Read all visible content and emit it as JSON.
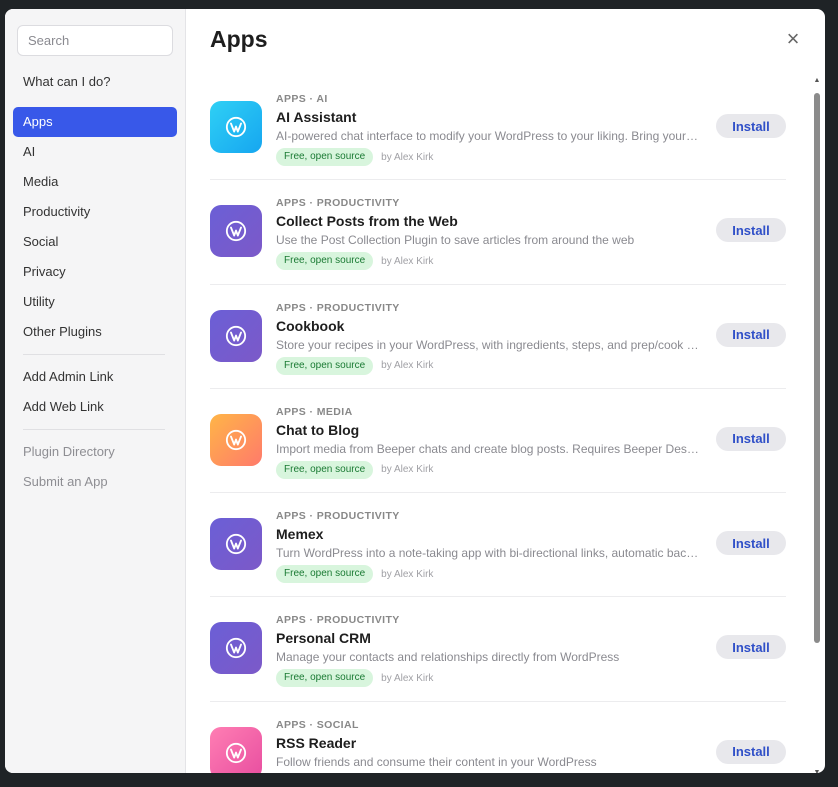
{
  "search": {
    "placeholder": "Search"
  },
  "sidebar": {
    "what_can": "What can I do?",
    "categories": [
      "Apps",
      "AI",
      "Media",
      "Productivity",
      "Social",
      "Privacy",
      "Utility",
      "Other Plugins"
    ],
    "links": [
      "Add Admin Link",
      "Add Web Link"
    ],
    "footer": [
      "Plugin Directory",
      "Submit an App"
    ]
  },
  "main": {
    "title": "Apps",
    "close": "×",
    "apps": [
      {
        "category": "APPS · AI",
        "name": "AI Assistant",
        "description": "AI-powered chat interface to modify your WordPress to your liking. Bring your own API key.",
        "badge": "Free, open source",
        "author": "by Alex Kirk",
        "button": "Install",
        "icon": "wordpress-icon",
        "gradient": [
          "#2fd0f5",
          "#16a6f0"
        ]
      },
      {
        "category": "APPS · PRODUCTIVITY",
        "name": "Collect Posts from the Web",
        "description": "Use the Post Collection Plugin to save articles from around the web",
        "badge": "Free, open source",
        "author": "by Alex Kirk",
        "button": "Install",
        "icon": "wordpress-icon",
        "gradient": [
          "#6b5fd6",
          "#7c59c8"
        ]
      },
      {
        "category": "APPS · PRODUCTIVITY",
        "name": "Cookbook",
        "description": "Store your recipes in your WordPress, with ingredients, steps, and prep/cook times.",
        "badge": "Free, open source",
        "author": "by Alex Kirk",
        "button": "Install",
        "icon": "wordpress-icon",
        "gradient": [
          "#6b5fd6",
          "#7c59c8"
        ]
      },
      {
        "category": "APPS · MEDIA",
        "name": "Chat to Blog",
        "description": "Import media from Beeper chats and create blog posts. Requires Beeper Desktop.",
        "badge": "Free, open source",
        "author": "by Alex Kirk",
        "button": "Install",
        "icon": "wordpress-icon",
        "gradient": [
          "#ffb547",
          "#ff7a6b"
        ]
      },
      {
        "category": "APPS · PRODUCTIVITY",
        "name": "Memex",
        "description": "Turn WordPress into a note-taking app with bi-directional links, automatic backlinks.",
        "badge": "Free, open source",
        "author": "by Alex Kirk",
        "button": "Install",
        "icon": "wordpress-icon",
        "gradient": [
          "#6b5fd6",
          "#7c59c8"
        ]
      },
      {
        "category": "APPS · PRODUCTIVITY",
        "name": "Personal CRM",
        "description": "Manage your contacts and relationships directly from WordPress",
        "badge": "Free, open source",
        "author": "by Alex Kirk",
        "button": "Install",
        "icon": "wordpress-icon",
        "gradient": [
          "#6b5fd6",
          "#7c59c8"
        ]
      },
      {
        "category": "APPS · SOCIAL",
        "name": "RSS Reader",
        "description": "Follow friends and consume their content in your WordPress",
        "badge": "Free, open source",
        "author": "by Alex Kirk",
        "button": "Install",
        "icon": "wordpress-icon",
        "gradient": [
          "#ff7eb3",
          "#e84ea0"
        ]
      }
    ]
  },
  "colors": {
    "accent": "#3858e9",
    "install_text": "#3050c8",
    "badge_bg": "#d8f5dd",
    "badge_text": "#1a7a33"
  }
}
